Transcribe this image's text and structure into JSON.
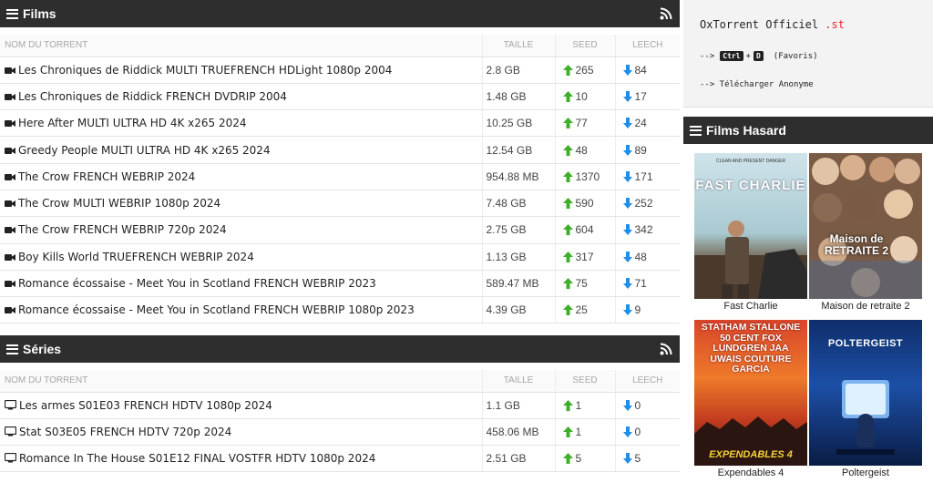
{
  "films_section": {
    "title": "Films",
    "columns": {
      "name": "NOM DU TORRENT",
      "size": "TAILLE",
      "seed": "SEED",
      "leech": "LEECH"
    },
    "rows": [
      {
        "name": "Les Chroniques de Riddick MULTI TRUEFRENCH HDLight 1080p 2004",
        "size": "2.8 GB",
        "seed": "265",
        "leech": "84"
      },
      {
        "name": "Les Chroniques de Riddick FRENCH DVDRIP 2004",
        "size": "1.48 GB",
        "seed": "10",
        "leech": "17"
      },
      {
        "name": "Here After MULTI ULTRA HD 4K x265 2024",
        "size": "10.25 GB",
        "seed": "77",
        "leech": "24"
      },
      {
        "name": "Greedy People MULTI ULTRA HD 4K x265 2024",
        "size": "12.54 GB",
        "seed": "48",
        "leech": "89"
      },
      {
        "name": "The Crow FRENCH WEBRIP 2024",
        "size": "954.88 MB",
        "seed": "1370",
        "leech": "171"
      },
      {
        "name": "The Crow MULTI WEBRIP 1080p 2024",
        "size": "7.48 GB",
        "seed": "590",
        "leech": "252"
      },
      {
        "name": "The Crow FRENCH WEBRIP 720p 2024",
        "size": "2.75 GB",
        "seed": "604",
        "leech": "342"
      },
      {
        "name": "Boy Kills World TRUEFRENCH WEBRIP 2024",
        "size": "1.13 GB",
        "seed": "317",
        "leech": "48"
      },
      {
        "name": "Romance écossaise - Meet You in Scotland FRENCH WEBRIP 2023",
        "size": "589.47 MB",
        "seed": "75",
        "leech": "71"
      },
      {
        "name": "Romance écossaise - Meet You in Scotland FRENCH WEBRIP 1080p 2023",
        "size": "4.39 GB",
        "seed": "25",
        "leech": "9"
      }
    ]
  },
  "series_section": {
    "title": "Séries",
    "columns": {
      "name": "NOM DU TORRENT",
      "size": "TAILLE",
      "seed": "SEED",
      "leech": "LEECH"
    },
    "rows": [
      {
        "name": "Les armes S01E03 FRENCH HDTV 1080p 2024",
        "size": "1.1 GB",
        "seed": "1",
        "leech": "0"
      },
      {
        "name": "Stat S03E05 FRENCH HDTV 720p 2024",
        "size": "458.06 MB",
        "seed": "1",
        "leech": "0"
      },
      {
        "name": "Romance In The House S01E12 FINAL VOSTFR HDTV 1080p 2024",
        "size": "2.51 GB",
        "seed": "5",
        "leech": "5"
      }
    ]
  },
  "info_box": {
    "title_main": "OxTorrent Officiel ",
    "title_accent": ".st",
    "line1_prefix": "-->",
    "key_ctrl": "Ctrl",
    "key_plus": "+",
    "key_d": "D",
    "line1_suffix": "(Favoris)",
    "line2": "--> Télécharger Anonyme"
  },
  "hasard": {
    "title": "Films Hasard",
    "posters": [
      {
        "caption": "Fast Charlie",
        "poster_title": "FAST CHARLIE",
        "tagline": "CLEAN AND PRESENT DANGER"
      },
      {
        "caption": "Maison de retraite 2",
        "poster_title": "Maison de RETRAITE 2",
        "tagline": ""
      },
      {
        "caption": "Expendables 4",
        "poster_title": "EXPENDABLES 4",
        "tagline": "STATHAM STALLONE 50 CENT FOX LUNDGREN JAA UWAIS COUTURE GARCIA"
      },
      {
        "caption": "Poltergeist",
        "poster_title": "POLTERGEIST",
        "tagline": ""
      }
    ]
  },
  "colors": {
    "header_bg": "#2e2e2e",
    "seed_green": "#3fae29",
    "leech_blue": "#1f8ee6",
    "accent_red": "#e8262a"
  }
}
